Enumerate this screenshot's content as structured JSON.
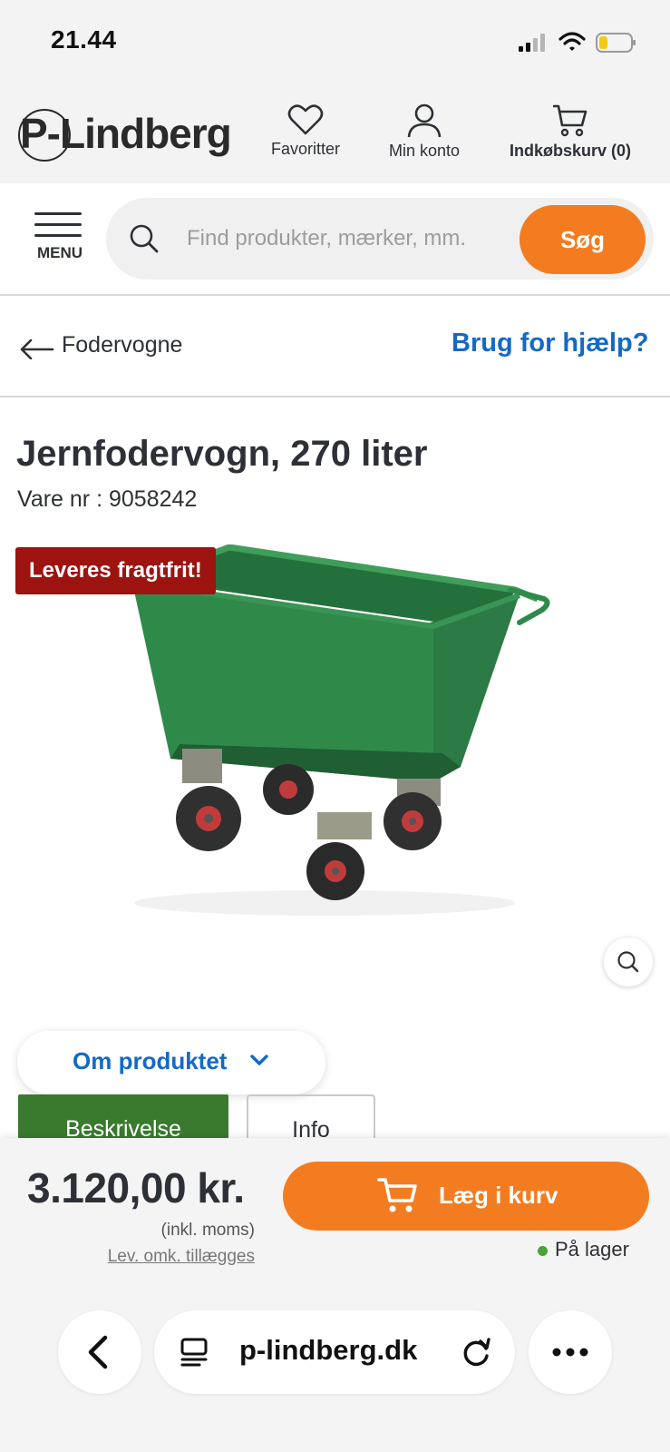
{
  "status_bar": {
    "time": "21.44"
  },
  "header": {
    "logo_text": "P-Lindberg",
    "favorites_label": "Favoritter",
    "account_label": "Min konto",
    "cart_label": "Indkøbskurv (0)"
  },
  "search": {
    "menu_label": "MENU",
    "placeholder": "Find produkter, mærker, mm.",
    "button_label": "Søg"
  },
  "breadcrumb": {
    "back_label": "Fodervogne",
    "help_link": "Brug for hjælp?"
  },
  "product": {
    "title": "Jernfodervogn, 270 liter",
    "sku": "Vare nr : 9058242",
    "badge": "Leveres fragtfrit!",
    "about_label": "Om produktet",
    "tabs": [
      {
        "label": "Beskrivelse",
        "active": true
      },
      {
        "label": "Info",
        "active": false
      }
    ]
  },
  "price_bar": {
    "price": "3.120,00 kr.",
    "vat_note": "(inkl. moms)",
    "shipping_note": "Lev. omk. tillægges",
    "add_to_cart": "Læg i kurv",
    "stock_status": "På lager",
    "stock_color": "#4aa238"
  },
  "browser": {
    "url": "p-lindberg.dk"
  },
  "colors": {
    "accent_orange": "#f47c20",
    "link_blue": "#1469c7",
    "badge_red": "#9c1310",
    "tab_green": "#3a7a2f"
  }
}
